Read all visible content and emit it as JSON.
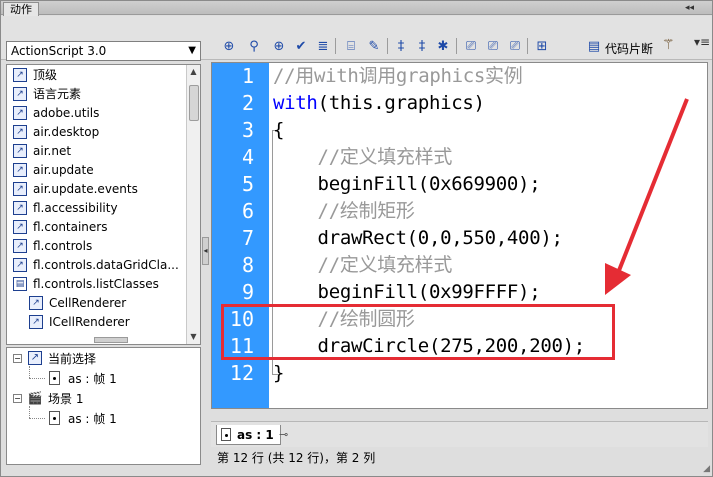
{
  "window": {
    "title": "动作",
    "collapse_glyph": "◂◂",
    "menu_glyph": "▾≡"
  },
  "left_panel": {
    "version_selected": "ActionScript 3.0",
    "library_items": [
      "顶级",
      "语言元素",
      "adobe.utils",
      "air.desktop",
      "air.net",
      "air.update",
      "air.update.events",
      "fl.accessibility",
      "fl.containers",
      "fl.controls",
      "fl.controls.dataGridCla...",
      "fl.controls.listClasses",
      "CellRenderer",
      "ICellRenderer"
    ],
    "tree": {
      "current_selection": "当前选择",
      "current_frame": "as : 帧 1",
      "scene": "场景 1",
      "scene_frame": "as : 帧 1"
    }
  },
  "toolbar": {
    "code_snippets_label": "代码片断",
    "icons": [
      "add-statement-icon",
      "find-icon",
      "target-path-icon",
      "check-syntax-icon",
      "auto-format-icon",
      "code-hint-icon",
      "debug-options-icon",
      "collapse-between-braces-icon",
      "collapse-selection-icon",
      "expand-all-icon",
      "apply-block-comment-icon",
      "apply-line-comment-icon",
      "remove-comment-icon",
      "show-hide-toolbox-icon"
    ]
  },
  "editor": {
    "line_numbers": [
      "1",
      "2",
      "3",
      "4",
      "5",
      "6",
      "7",
      "8",
      "9",
      "10",
      "11",
      "12"
    ],
    "lines": [
      {
        "text": "//用with调用graphics实例",
        "kind": "comment"
      },
      {
        "text": "with",
        "kind": "keyword",
        "rest": "(this.graphics)"
      },
      {
        "text": "{",
        "kind": "plain"
      },
      {
        "text": "    //定义填充样式",
        "kind": "comment"
      },
      {
        "text": "    beginFill(0x669900);",
        "kind": "plain"
      },
      {
        "text": "    //绘制矩形",
        "kind": "comment"
      },
      {
        "text": "    drawRect(0,0,550,400);",
        "kind": "plain"
      },
      {
        "text": "    //定义填充样式",
        "kind": "comment"
      },
      {
        "text": "    beginFill(0x99FFFF);",
        "kind": "plain"
      },
      {
        "text": "    //绘制圆形",
        "kind": "comment"
      },
      {
        "text": "    drawCircle(275,200,200);",
        "kind": "plain"
      },
      {
        "text": "}",
        "kind": "plain"
      }
    ],
    "gutter_color": "#3399ff",
    "comment_color": "#999999",
    "keyword_color": "#0000ff",
    "highlight_color": "#e52c34"
  },
  "bottom": {
    "file_tab": "as : 1",
    "status": "第 12 行 (共 12 行)，第 2 列"
  }
}
